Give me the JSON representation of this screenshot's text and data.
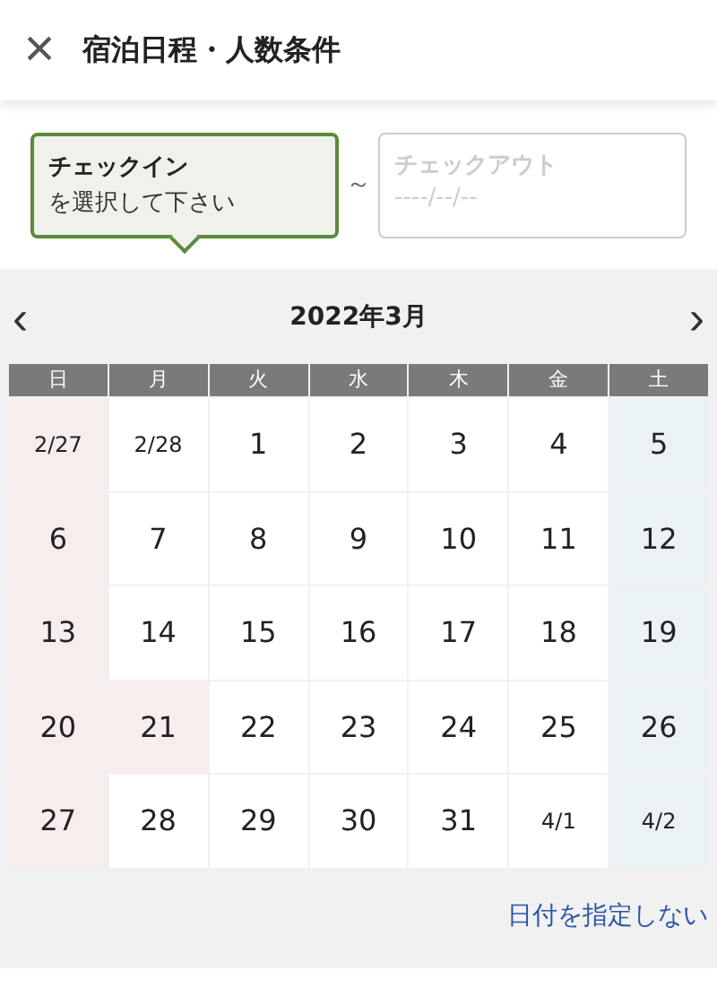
{
  "header": {
    "close": "×",
    "title": "宿泊日程・人数条件"
  },
  "fields": [
    {
      "label": "チェックイン",
      "value": "を選択して下さい",
      "selected": true
    },
    {
      "label": "チェックアウト",
      "value": "----/--/--",
      "selected": false
    }
  ],
  "separator": "～",
  "calendar": {
    "prev": "‹",
    "month": "2022年3月",
    "next": "›",
    "weekdays": [
      "日",
      "月",
      "火",
      "水",
      "木",
      "金",
      "土"
    ],
    "weeks": [
      [
        {
          "day": "2/27",
          "kind": "holiday",
          "other_month": true
        },
        {
          "day": "2/28",
          "kind": "weekday",
          "other_month": true
        },
        {
          "day": "1",
          "kind": "weekday",
          "other_month": false
        },
        {
          "day": "2",
          "kind": "weekday",
          "other_month": false
        },
        {
          "day": "3",
          "kind": "weekday",
          "other_month": false
        },
        {
          "day": "4",
          "kind": "weekday",
          "other_month": false
        },
        {
          "day": "5",
          "kind": "saturday",
          "other_month": false
        }
      ],
      [
        {
          "day": "6",
          "kind": "holiday",
          "other_month": false
        },
        {
          "day": "7",
          "kind": "weekday",
          "other_month": false
        },
        {
          "day": "8",
          "kind": "weekday",
          "other_month": false
        },
        {
          "day": "9",
          "kind": "weekday",
          "other_month": false
        },
        {
          "day": "10",
          "kind": "weekday",
          "other_month": false
        },
        {
          "day": "11",
          "kind": "weekday",
          "other_month": false
        },
        {
          "day": "12",
          "kind": "saturday",
          "other_month": false
        }
      ],
      [
        {
          "day": "13",
          "kind": "holiday",
          "other_month": false
        },
        {
          "day": "14",
          "kind": "weekday",
          "other_month": false
        },
        {
          "day": "15",
          "kind": "weekday",
          "other_month": false
        },
        {
          "day": "16",
          "kind": "weekday",
          "other_month": false
        },
        {
          "day": "17",
          "kind": "weekday",
          "other_month": false
        },
        {
          "day": "18",
          "kind": "weekday",
          "other_month": false
        },
        {
          "day": "19",
          "kind": "saturday",
          "other_month": false
        }
      ],
      [
        {
          "day": "20",
          "kind": "holiday",
          "other_month": false
        },
        {
          "day": "21",
          "kind": "holiday",
          "other_month": false
        },
        {
          "day": "22",
          "kind": "weekday",
          "other_month": false
        },
        {
          "day": "23",
          "kind": "weekday",
          "other_month": false
        },
        {
          "day": "24",
          "kind": "weekday",
          "other_month": false
        },
        {
          "day": "25",
          "kind": "weekday",
          "other_month": false
        },
        {
          "day": "26",
          "kind": "saturday",
          "other_month": false
        }
      ],
      [
        {
          "day": "27",
          "kind": "holiday",
          "other_month": false
        },
        {
          "day": "28",
          "kind": "weekday",
          "other_month": false
        },
        {
          "day": "29",
          "kind": "weekday",
          "other_month": false
        },
        {
          "day": "30",
          "kind": "weekday",
          "other_month": false
        },
        {
          "day": "31",
          "kind": "weekday",
          "other_month": false
        },
        {
          "day": "4/1",
          "kind": "weekday",
          "other_month": true
        },
        {
          "day": "4/2",
          "kind": "saturday",
          "other_month": true
        }
      ]
    ]
  },
  "clear_link": "日付を指定しない"
}
